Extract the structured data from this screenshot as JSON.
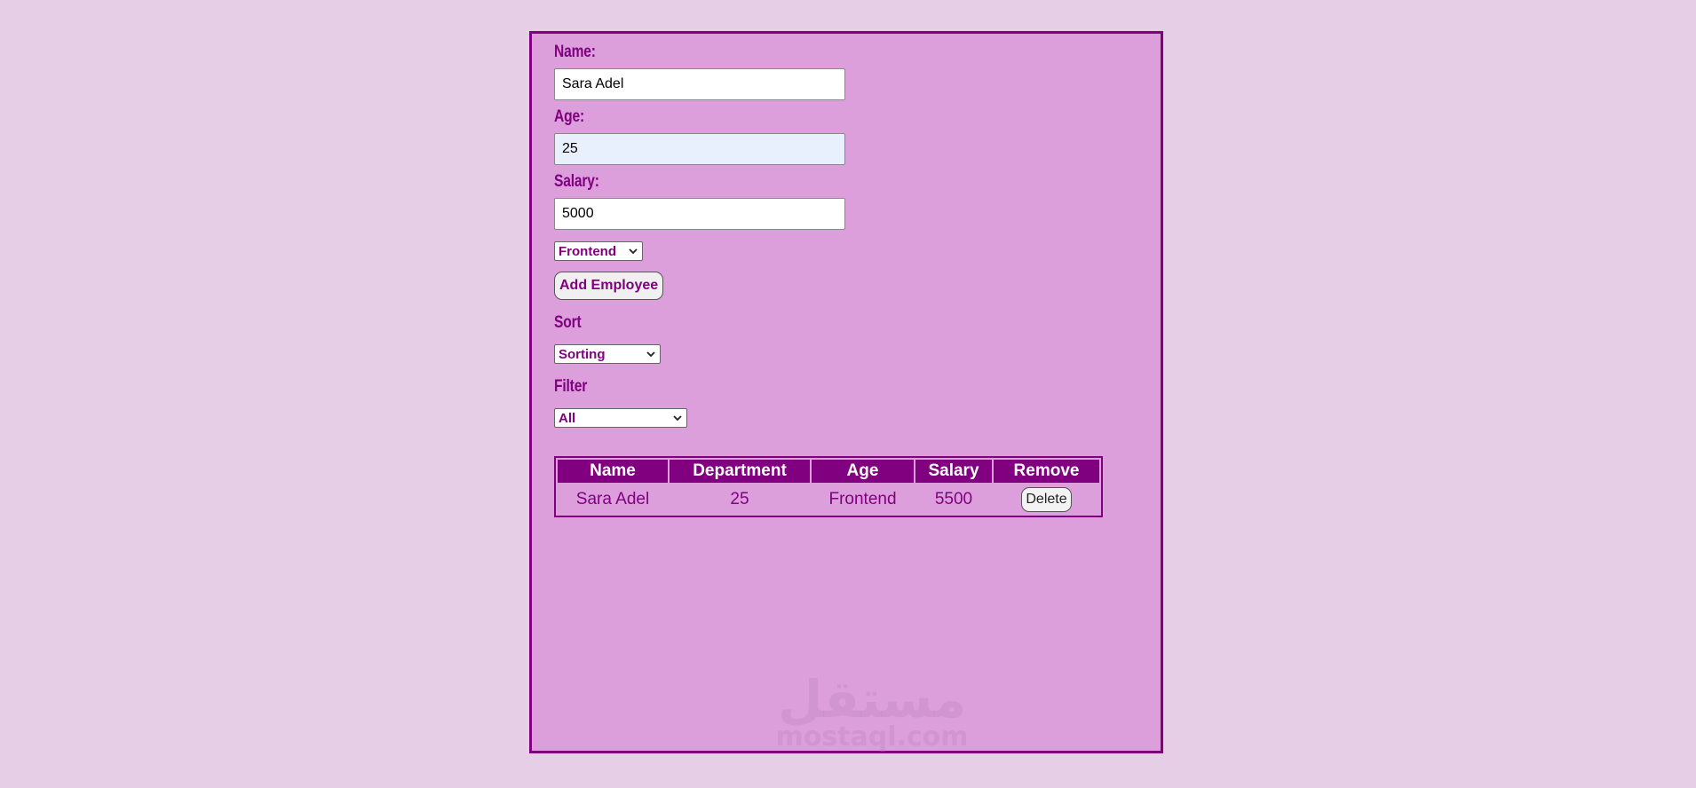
{
  "form": {
    "name_label": "Name:",
    "name_value": "Sara Adel",
    "age_label": "Age:",
    "age_value": "25",
    "salary_label": "Salary:",
    "salary_value": "5000",
    "department_selected": "Frontend",
    "add_button": "Add Employee"
  },
  "sort": {
    "label": "Sort",
    "selected": "Sorting"
  },
  "filter": {
    "label": "Filter",
    "selected": "All"
  },
  "table": {
    "headers": [
      "Name",
      "Department",
      "Age",
      "Salary",
      "Remove"
    ],
    "rows": [
      {
        "name": "Sara Adel",
        "department": "25",
        "age": "Frontend",
        "salary": "5500",
        "remove_label": "Delete"
      }
    ]
  },
  "watermark": {
    "arabic": "مستقل",
    "latin": "mostaql.com"
  },
  "colors": {
    "page_bg": "#e6cfe6",
    "panel_bg": "#dc9fdc",
    "accent": "#800080"
  }
}
